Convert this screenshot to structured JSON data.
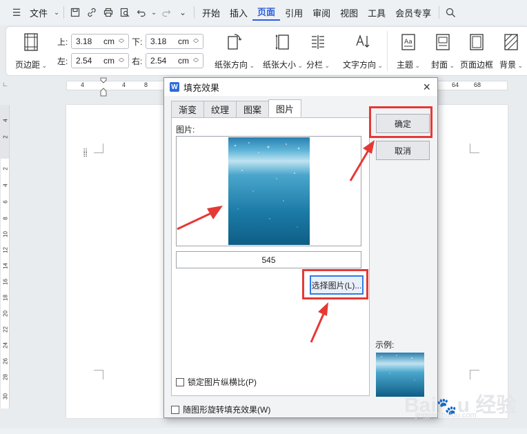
{
  "menubar": {
    "file_label": "文件",
    "items": [
      "开始",
      "插入",
      "页面",
      "引用",
      "审阅",
      "视图",
      "工具",
      "会员专享"
    ],
    "active_item": "页面"
  },
  "ribbon": {
    "margins_label": "页边距",
    "top_label": "上:",
    "top_value": "3.18",
    "top_unit": "cm",
    "bottom_label": "下:",
    "bottom_value": "3.18",
    "bottom_unit": "cm",
    "left_label": "左:",
    "left_value": "2.54",
    "left_unit": "cm",
    "right_label": "右:",
    "right_value": "2.54",
    "right_unit": "cm",
    "orientation_label": "纸张方向",
    "size_label": "纸张大小",
    "columns_label": "分栏",
    "text_direction_label": "文字方向",
    "theme_label": "主题",
    "cover_label": "封面",
    "page_border_label": "页面边框",
    "background_label": "背景"
  },
  "ruler": {
    "top_ticks": [
      "4",
      "4",
      "8",
      "64",
      "68"
    ],
    "left_ticks": [
      "4",
      "2",
      "2",
      "4",
      "6",
      "8",
      "10",
      "12",
      "14",
      "16",
      "18",
      "20",
      "22",
      "24",
      "26",
      "28",
      "30"
    ]
  },
  "dialog": {
    "title": "填充效果",
    "tabs": [
      "渐变",
      "纹理",
      "图案",
      "图片"
    ],
    "active_tab": "图片",
    "picture_label": "图片:",
    "picture_name": "545",
    "select_button": "选择图片(L)...",
    "lock_ratio_label": "锁定图片纵横比(P)",
    "rotate_fill_label": "随图形旋转填充效果(W)",
    "ok_button": "确定",
    "cancel_button": "取消",
    "sample_label": "示例:"
  },
  "colors": {
    "accent": "#2b5fd9",
    "highlight": "#e53935",
    "water_dark": "#0f5e86",
    "water_light": "#3b9ec8"
  }
}
